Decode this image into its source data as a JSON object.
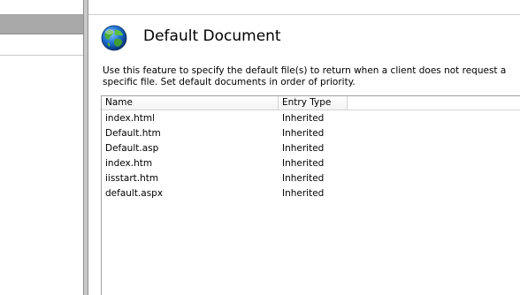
{
  "feature": {
    "title": "Default Document",
    "icon": "globe-document-icon",
    "description": "Use this feature to specify the default file(s) to return when a client does not request a specific file. Set default documents in order of priority."
  },
  "list": {
    "columns": [
      "Name",
      "Entry Type"
    ],
    "rows": [
      {
        "name": "index.html",
        "entry_type": "Inherited"
      },
      {
        "name": "Default.htm",
        "entry_type": "Inherited"
      },
      {
        "name": "Default.asp",
        "entry_type": "Inherited"
      },
      {
        "name": "index.htm",
        "entry_type": "Inherited"
      },
      {
        "name": "iisstart.htm",
        "entry_type": "Inherited"
      },
      {
        "name": "default.aspx",
        "entry_type": "Inherited"
      }
    ]
  },
  "colors": {
    "left_header_bar": "#a8a8a8",
    "splitter": "#c9c9c9",
    "border": "#a0a0a0"
  }
}
